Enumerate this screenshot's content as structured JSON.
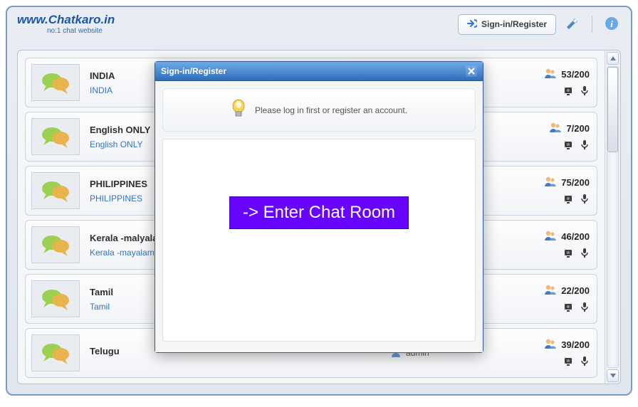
{
  "brand": {
    "site": "www.Chatkaro.in",
    "tagline": "no:1 chat website"
  },
  "header": {
    "signin_label": "Sign-in/Register"
  },
  "rooms": [
    {
      "title": "INDIA",
      "link": "INDIA",
      "admin": "",
      "count": "53/200"
    },
    {
      "title": "English ONLY",
      "link": "English ONLY",
      "admin": "",
      "count": "7/200"
    },
    {
      "title": "PHILIPPINES",
      "link": "PHILIPPINES",
      "admin": "",
      "count": "75/200"
    },
    {
      "title": "Kerala -malyalam",
      "link": "Kerala -mayalam",
      "admin": "",
      "count": "46/200"
    },
    {
      "title": "Tamil",
      "link": "Tamil",
      "admin": "",
      "count": "22/200"
    },
    {
      "title": "Telugu",
      "link": "",
      "admin": "admin",
      "count": "39/200"
    }
  ],
  "modal": {
    "title": "Sign-in/Register",
    "message": "Please log in first or register an account.",
    "enter_label": "-> Enter Chat Room"
  },
  "icons": {
    "arrow_in": "→)",
    "wrench": "wrench",
    "info": "i"
  }
}
